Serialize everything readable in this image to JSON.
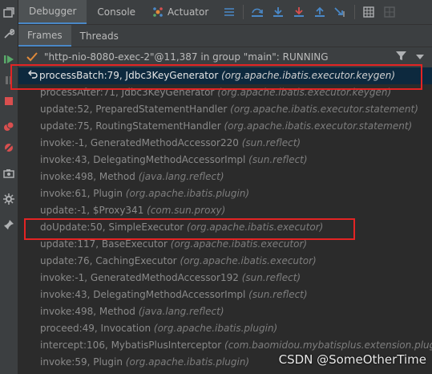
{
  "tabs": [
    {
      "label": "Debugger",
      "active": true
    },
    {
      "label": "Console",
      "active": false
    },
    {
      "label": "Actuator",
      "active": false
    }
  ],
  "subtabs": [
    {
      "label": "Frames",
      "active": true
    },
    {
      "label": "Threads",
      "active": false
    }
  ],
  "thread": {
    "label": "\"http-nio-8080-exec-2\"@11,387 in group \"main\": RUNNING"
  },
  "frames": [
    {
      "method": "processBatch:79, Jdbc3KeyGenerator",
      "pkg": "(org.apache.ibatis.executor.keygen)",
      "selected": true
    },
    {
      "method": "processAfter:71, Jdbc3KeyGenerator",
      "pkg": "(org.apache.ibatis.executor.keygen)"
    },
    {
      "method": "update:52, PreparedStatementHandler",
      "pkg": "(org.apache.ibatis.executor.statement)"
    },
    {
      "method": "update:75, RoutingStatementHandler",
      "pkg": "(org.apache.ibatis.executor.statement)"
    },
    {
      "method": "invoke:-1, GeneratedMethodAccessor220",
      "pkg": "(sun.reflect)"
    },
    {
      "method": "invoke:43, DelegatingMethodAccessorImpl",
      "pkg": "(sun.reflect)"
    },
    {
      "method": "invoke:498, Method",
      "pkg": "(java.lang.reflect)"
    },
    {
      "method": "invoke:61, Plugin",
      "pkg": "(org.apache.ibatis.plugin)"
    },
    {
      "method": "update:-1, $Proxy341",
      "pkg": "(com.sun.proxy)"
    },
    {
      "method": "doUpdate:50, SimpleExecutor",
      "pkg": "(org.apache.ibatis.executor)"
    },
    {
      "method": "update:117, BaseExecutor",
      "pkg": "(org.apache.ibatis.executor)"
    },
    {
      "method": "update:76, CachingExecutor",
      "pkg": "(org.apache.ibatis.executor)"
    },
    {
      "method": "invoke:-1, GeneratedMethodAccessor192",
      "pkg": "(sun.reflect)"
    },
    {
      "method": "invoke:43, DelegatingMethodAccessorImpl",
      "pkg": "(sun.reflect)"
    },
    {
      "method": "invoke:498, Method",
      "pkg": "(java.lang.reflect)"
    },
    {
      "method": "proceed:49, Invocation",
      "pkg": "(org.apache.ibatis.plugin)"
    },
    {
      "method": "intercept:106, MybatisPlusInterceptor",
      "pkg": "(com.baomidou.mybatisplus.extension.plugins)"
    },
    {
      "method": "invoke:59, Plugin",
      "pkg": "(org.apache.ibatis.plugin)"
    }
  ],
  "watermark": "CSDN @SomeOtherTime",
  "colors": {
    "accent": "#4a88c7",
    "highlight_box": "#e32424",
    "selected_row": "#0d293e"
  }
}
